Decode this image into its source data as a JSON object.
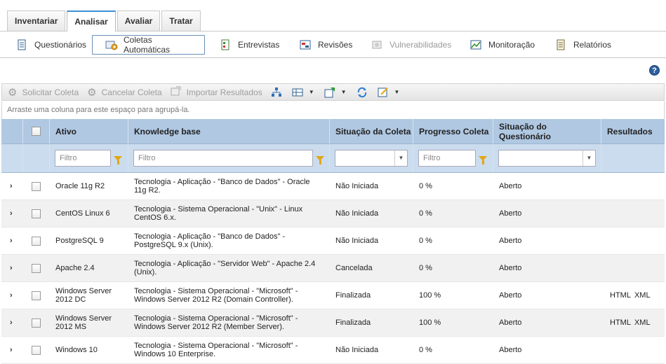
{
  "top_tabs": [
    {
      "label": "Inventariar",
      "active": false
    },
    {
      "label": "Analisar",
      "active": true
    },
    {
      "label": "Avaliar",
      "active": false
    },
    {
      "label": "Tratar",
      "active": false
    }
  ],
  "subnav": [
    {
      "label": "Questionários",
      "icon": "questionnaire-icon",
      "state": "normal"
    },
    {
      "label": "Coletas Automáticas",
      "icon": "automatic-collection-icon",
      "state": "active"
    },
    {
      "label": "Entrevistas",
      "icon": "interview-icon",
      "state": "normal"
    },
    {
      "label": "Revisões",
      "icon": "review-icon",
      "state": "normal"
    },
    {
      "label": "Vulnerabilidades",
      "icon": "vulnerability-icon",
      "state": "disabled"
    },
    {
      "label": "Monitoração",
      "icon": "monitoring-icon",
      "state": "normal"
    },
    {
      "label": "Relatórios",
      "icon": "report-icon",
      "state": "normal"
    }
  ],
  "toolbar": {
    "request_label": "Solicitar Coleta",
    "cancel_label": "Cancelar Coleta",
    "import_label": "Importar Resultados"
  },
  "group_hint": "Arraste uma coluna para este espaço para agrupá-la.",
  "columns": {
    "ativo": "Ativo",
    "kb": "Knowledge base",
    "situacao_coleta": "Situação da Coleta",
    "progresso": "Progresso Coleta",
    "situacao_questionario": "Situação do Questionário",
    "resultados": "Resultados"
  },
  "filters": {
    "ativo_placeholder": "Filtro",
    "kb_placeholder": "Filtro",
    "progresso_placeholder": "Filtro"
  },
  "rows": [
    {
      "ativo": "Oracle 11g R2",
      "kb": "Tecnologia - Aplicação - \"Banco de Dados\" - Oracle 11g R2.",
      "situacao": "Não Iniciada",
      "progresso": "0 %",
      "questionario": "Aberto",
      "html": "",
      "xml": ""
    },
    {
      "ativo": "CentOS Linux 6",
      "kb": "Tecnologia - Sistema Operacional - \"Unix\" - Linux CentOS 6.x.",
      "situacao": "Não Iniciada",
      "progresso": "0 %",
      "questionario": "Aberto",
      "html": "",
      "xml": ""
    },
    {
      "ativo": "PostgreSQL 9",
      "kb": "Tecnologia - Aplicação - \"Banco de Dados\" - PostgreSQL 9.x (Unix).",
      "situacao": "Não Iniciada",
      "progresso": "0 %",
      "questionario": "Aberto",
      "html": "",
      "xml": ""
    },
    {
      "ativo": "Apache 2.4",
      "kb": "Tecnologia - Aplicação - \"Servidor Web\" - Apache 2.4 (Unix).",
      "situacao": "Cancelada",
      "progresso": "0 %",
      "questionario": "Aberto",
      "html": "",
      "xml": ""
    },
    {
      "ativo": "Windows Server 2012 DC",
      "kb": "Tecnologia - Sistema Operacional - \"Microsoft\" - Windows Server 2012 R2 (Domain Controller).",
      "situacao": "Finalizada",
      "progresso": "100 %",
      "questionario": "Aberto",
      "html": "HTML",
      "xml": "XML"
    },
    {
      "ativo": "Windows Server 2012 MS",
      "kb": "Tecnologia - Sistema Operacional - \"Microsoft\" - Windows Server 2012 R2 (Member Server).",
      "situacao": "Finalizada",
      "progresso": "100 %",
      "questionario": "Aberto",
      "html": "HTML",
      "xml": "XML"
    },
    {
      "ativo": "Windows 10",
      "kb": "Tecnologia - Sistema Operacional - \"Microsoft\" - Windows 10 Enterprise.",
      "situacao": "Não Iniciada",
      "progresso": "0 %",
      "questionario": "Aberto",
      "html": "",
      "xml": ""
    }
  ],
  "help_label": "?"
}
